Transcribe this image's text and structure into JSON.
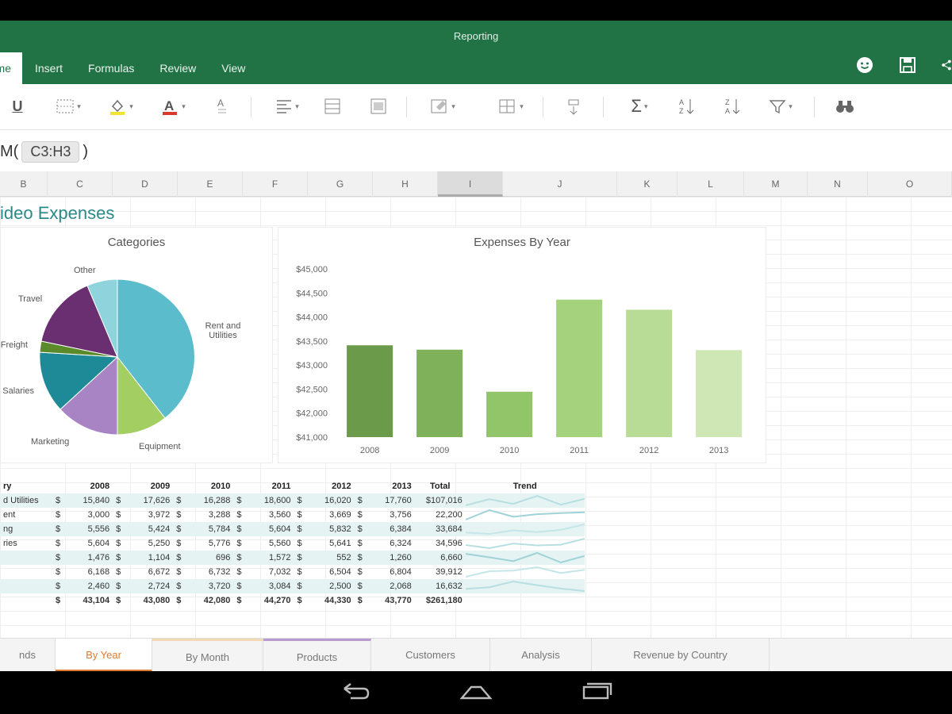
{
  "app": {
    "doc_title": "Reporting"
  },
  "ribbon": {
    "tabs": [
      "Home",
      "Insert",
      "Formulas",
      "Review",
      "View"
    ],
    "active_tab_index": 0,
    "icons": [
      "smiley-icon",
      "save-icon",
      "share-icon"
    ]
  },
  "toolbar": {
    "items": [
      "underline",
      "borders",
      "fill-color",
      "font-color",
      "text-style",
      "align-left",
      "wrap-text",
      "merge-cells",
      "format-cells",
      "insert-cells",
      "sort",
      "autosum",
      "sort-ascending",
      "sort-descending",
      "filter",
      "find"
    ]
  },
  "formula": {
    "prefix": "M(",
    "reference": "C3:H3",
    "suffix": ")"
  },
  "columns": [
    "B",
    "C",
    "D",
    "E",
    "F",
    "G",
    "H",
    "I",
    "J",
    "K",
    "L",
    "M",
    "N",
    "O"
  ],
  "selected_column": "I",
  "sheet": {
    "title": "ideo Expenses"
  },
  "pie_chart": {
    "title": "Categories",
    "labels": [
      "Other",
      "Travel",
      "Freight",
      "Salaries",
      "Marketing",
      "Equipment",
      "Rent and Utilities"
    ]
  },
  "chart_data": {
    "type": "bar",
    "title": "Expenses By Year",
    "categories": [
      "2008",
      "2009",
      "2010",
      "2011",
      "2012",
      "2013"
    ],
    "values": [
      43184,
      43080,
      42080,
      44270,
      44030,
      43070
    ],
    "ylim": [
      41000,
      45000
    ],
    "ytick_labels": [
      "$45,000",
      "$44,500",
      "$44,000",
      "$43,500",
      "$43,000",
      "$42,500",
      "$42,000",
      "$41,000"
    ],
    "colors": [
      "#6a9a4a",
      "#7fb05a",
      "#92c46a",
      "#a5d27c",
      "#b8dc96",
      "#cfe6b5"
    ]
  },
  "table": {
    "headers": [
      "ry",
      "2008",
      "2009",
      "2010",
      "2011",
      "2012",
      "2013",
      "Total",
      "Trend"
    ],
    "rows": [
      {
        "cat": "d Utilities",
        "vals": [
          "15,840",
          "17,626",
          "16,288",
          "18,600",
          "16,020",
          "17,760"
        ],
        "total": "$107,016",
        "band": true
      },
      {
        "cat": "ent",
        "vals": [
          "3,000",
          "3,972",
          "3,288",
          "3,560",
          "3,669",
          "3,756"
        ],
        "total": "22,200",
        "band": false
      },
      {
        "cat": "ng",
        "vals": [
          "5,556",
          "5,424",
          "5,784",
          "5,604",
          "5,832",
          "6,384"
        ],
        "total": "33,684",
        "band": true
      },
      {
        "cat": "ries",
        "vals": [
          "5,604",
          "5,250",
          "5,776",
          "5,560",
          "5,641",
          "6,324"
        ],
        "total": "34,596",
        "band": false
      },
      {
        "cat": "",
        "vals": [
          "1,476",
          "1,104",
          "696",
          "1,572",
          "552",
          "1,260"
        ],
        "total": "6,660",
        "band": true
      },
      {
        "cat": "",
        "vals": [
          "6,168",
          "6,672",
          "6,732",
          "7,032",
          "6,504",
          "6,804"
        ],
        "total": "39,912",
        "band": false
      },
      {
        "cat": "",
        "vals": [
          "2,460",
          "2,724",
          "3,720",
          "3,084",
          "2,500",
          "2,068"
        ],
        "total": "16,632",
        "band": true
      }
    ],
    "total_row": {
      "vals": [
        "43,104",
        "43,080",
        "42,080",
        "44,270",
        "44,330",
        "43,770"
      ],
      "total": "$261,180"
    },
    "currency": "$"
  },
  "sheet_tabs": [
    "nds",
    "By Year",
    "By Month",
    "Products",
    "Customers",
    "Analysis",
    "Revenue by Country"
  ],
  "active_sheet_tab_index": 1,
  "nav": {
    "back": "back-icon",
    "home": "home-icon",
    "recents": "recents-icon"
  }
}
